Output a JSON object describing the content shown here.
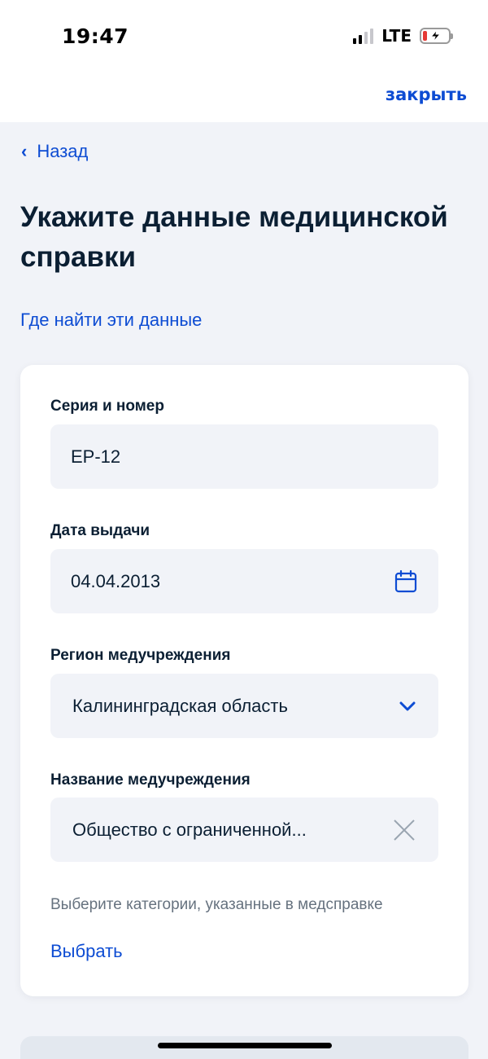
{
  "status_bar": {
    "time": "19:47",
    "network": "LTE",
    "icons": [
      "signal-icon",
      "battery-charging-icon"
    ]
  },
  "header": {
    "close_label": "закрыть"
  },
  "nav": {
    "back_label": "Назад",
    "back_icon": "chevron-left-icon"
  },
  "page": {
    "title": "Укажите данные медицинской справки",
    "help_link": "Где найти эти данные"
  },
  "form": {
    "series_number": {
      "label": "Серия и номер",
      "value": "ЕР-12"
    },
    "issue_date": {
      "label": "Дата выдачи",
      "value": "04.04.2013",
      "icon": "calendar-icon"
    },
    "region": {
      "label": "Регион медучреждения",
      "value": "Калининградская область",
      "icon": "chevron-down-icon"
    },
    "institution": {
      "label": "Название медучреждения",
      "value": "Общество с ограниченной...",
      "icon": "clear-icon"
    },
    "categories_hint": "Выберите категории, указанные в медсправке",
    "choose_label": "Выбрать"
  },
  "colors": {
    "accent": "#0d4cd3",
    "text": "#0b1f33",
    "muted": "#66727f",
    "background": "#f1f3f8",
    "card": "#ffffff"
  }
}
